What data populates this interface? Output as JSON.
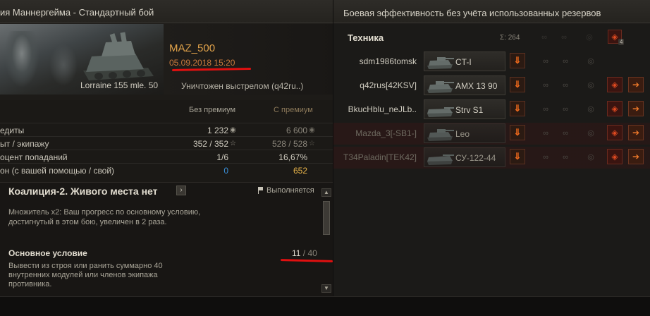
{
  "left": {
    "title": "ия Маннергейма - Стандартный бой",
    "hero": {
      "tank_name": "Lorraine 155 mle. 50",
      "player": "MAZ_500",
      "datetime": "05.09.2018 15:20",
      "killed": "Уничтожен выстрелом (q42ru..)"
    },
    "stats": {
      "col_no_premium": "Без премиум",
      "col_premium": "С премиум",
      "rows": [
        {
          "label": "едиты",
          "no_premium": "1 232",
          "premium": "6 600",
          "icon": "credits-icon"
        },
        {
          "label": "ыт / экипажу",
          "no_premium": "352 / 352",
          "premium": "528 / 528",
          "icon": "star-icon"
        },
        {
          "label": "оцент попаданий",
          "no_premium": "1/6",
          "premium": "16,67%",
          "icon": ""
        },
        {
          "label": "он (с вашей помощью / свой)",
          "no_premium": "0",
          "premium": "652",
          "icon": ""
        }
      ]
    },
    "quest": {
      "title": "Коалиция-2. Живого места нет",
      "status": "Выполняется",
      "multiplier_text": "Множитель x2: Ваш прогресс по основному условию, достигнутый в этом бою, увеличен в 2 раза.",
      "condition_title": "Основное условие",
      "progress_current": "11",
      "progress_total": " / 40",
      "description": "Вывести из строя или ранить суммарно 40 внутренних модулей или членов экипажа противника."
    }
  },
  "right": {
    "title": "Боевая эффективность без учёта использованных резервов",
    "eff_title": "Техника",
    "total_label": "Σ:  264",
    "spot_badge": "4",
    "rows": [
      {
        "player": "sdm1986tomsk",
        "vehicle": "CT-I",
        "dead": false,
        "has_crit": false
      },
      {
        "player": "q42rus[42KSV]",
        "vehicle": "AMX 13 90",
        "dead": false,
        "has_crit": true
      },
      {
        "player": "BkucHblu_neJLb..",
        "vehicle": "Strv S1",
        "dead": false,
        "has_crit": true
      },
      {
        "player": "Mazda_3[-SB1-]",
        "vehicle": "Leo",
        "dead": true,
        "has_crit": true
      },
      {
        "player": "T34Paladin[TEK42]",
        "vehicle": "СУ-122-44",
        "dead": true,
        "has_crit": true
      }
    ]
  },
  "colors": {
    "accent_orange": "#e0a24a",
    "premium_gold": "#e8b44a",
    "xp_blue": "#3a8fd8",
    "annotation_red": "#e01010"
  }
}
